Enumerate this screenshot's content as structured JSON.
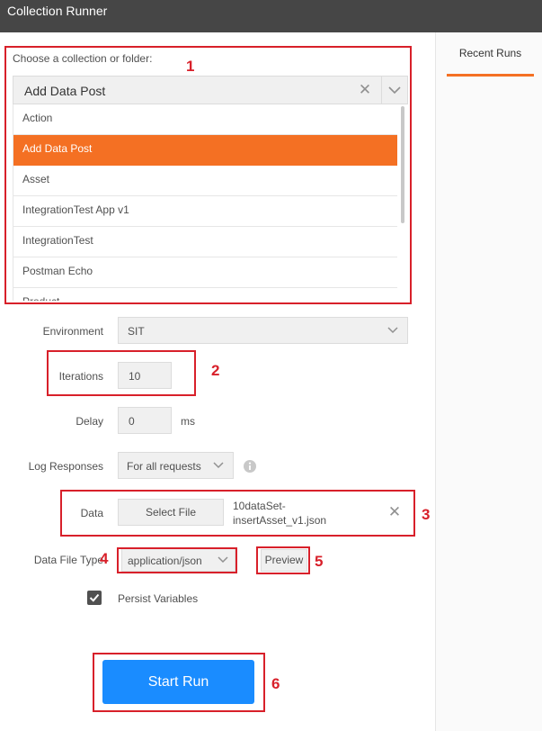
{
  "window": {
    "title": "Collection Runner"
  },
  "recent_runs": {
    "tab_label": "Recent Runs"
  },
  "collection": {
    "hint": "Choose a collection or folder:",
    "selected": "Add Data Post",
    "items": [
      "Action",
      "Add Data Post",
      "Asset",
      "IntegrationTest App v1",
      "IntegrationTest",
      "Postman Echo",
      "Product"
    ]
  },
  "environment": {
    "label": "Environment",
    "value": "SIT"
  },
  "iterations": {
    "label": "Iterations",
    "value": "10"
  },
  "delay": {
    "label": "Delay",
    "value": "0",
    "unit": "ms"
  },
  "log_responses": {
    "label": "Log Responses",
    "value": "For all requests"
  },
  "data": {
    "label": "Data",
    "select_label": "Select File",
    "file_line1": "10dataSet-",
    "file_line2": "insertAsset_v1.json"
  },
  "data_file_type": {
    "label": "Data File Type",
    "value": "application/json",
    "preview_label": "Preview"
  },
  "persist": {
    "label": "Persist Variables",
    "checked": true
  },
  "start_run": {
    "label": "Start Run"
  },
  "annotations": [
    "1",
    "2",
    "3",
    "4",
    "5",
    "6"
  ],
  "colors": {
    "titlebar": "#464646",
    "accent": "#f47023",
    "primary": "#1a8cff",
    "annotation": "#d8202a"
  }
}
